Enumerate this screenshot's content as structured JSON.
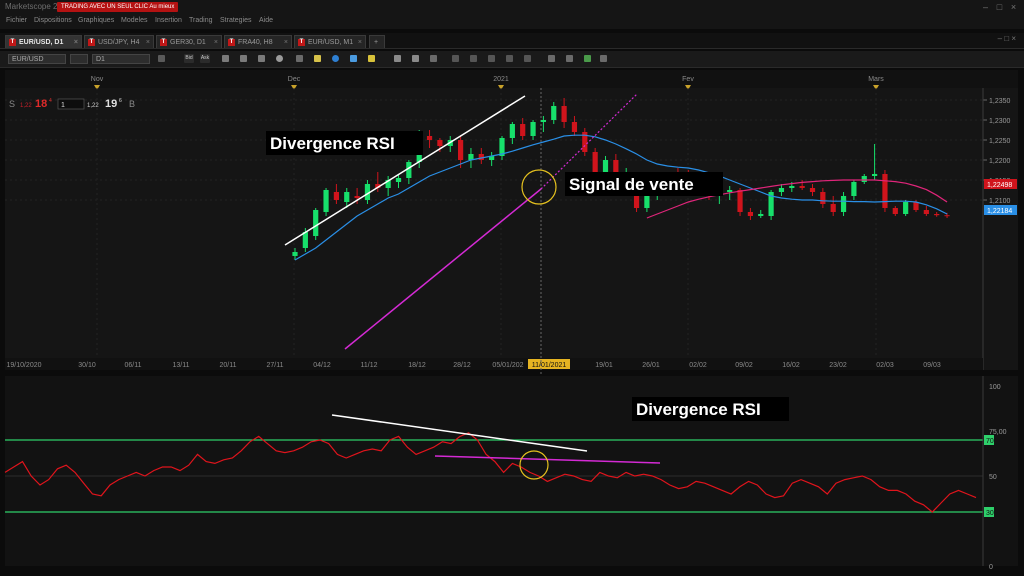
{
  "app": {
    "title": "Marketscope 2.0",
    "promo_badge": "TRADING AVEC UN SEUL CLIC Au mieux"
  },
  "menu": [
    "Fichier",
    "Dispositions",
    "Graphiques",
    "Modeles",
    "Insertion",
    "Trading",
    "Strategies",
    "Aide"
  ],
  "tabs": [
    {
      "label": "EUR/USD, D1",
      "active": true
    },
    {
      "label": "USD/JPY, H4",
      "active": false
    },
    {
      "label": "GER30, D1",
      "active": false
    },
    {
      "label": "FRA40, H8",
      "active": false
    },
    {
      "label": "EUR/USD, M1",
      "active": false
    }
  ],
  "toolbar": {
    "symbol": "EUR/USD",
    "timeframe": "D1",
    "bid_label": "Bid",
    "ask_label": "Ask"
  },
  "quote": {
    "sell_label": "S",
    "sell_prefix": "1,22",
    "sell_big": "18",
    "sell_sup": "4",
    "lots": "1",
    "buy_prefix": "1,22",
    "buy_big": "19",
    "buy_sup": "6",
    "buy_label": "B"
  },
  "months": [
    "Nov",
    "Dec",
    "2021",
    "Fev",
    "Mars"
  ],
  "price_axis": [
    "1,2350",
    "1,2300",
    "1,2250",
    "1,2200",
    "1,2150",
    "1,2100"
  ],
  "price_markers": {
    "red": "1,22498",
    "blue": "1,22184"
  },
  "date_axis": [
    "19/10/2020",
    "30/10",
    "06/11",
    "13/11",
    "20/11",
    "27/11",
    "04/12",
    "11/12",
    "18/12",
    "28/12",
    "05/01/202",
    "11/01/2021",
    "19/01",
    "26/01",
    "02/02",
    "09/02",
    "16/02",
    "23/02",
    "02/03",
    "09/03"
  ],
  "rsi_axis": [
    "100",
    "75,00",
    "70",
    "50",
    "30",
    "0"
  ],
  "annotations": {
    "divergence_top": "Divergence RSI",
    "signal": "Signal de vente",
    "divergence_rsi": "Divergence RSI"
  },
  "colors": {
    "bull": "#17e06b",
    "bear": "#d0141c",
    "ma_fast": "#2a8fe6",
    "ma_slow": "#e0257a",
    "trend": "#d42ad4",
    "rsi": "#e0141c",
    "rsi_levels": "#2ecf6a"
  },
  "chart_data": {
    "type": "candlestick",
    "x": [
      "27/11",
      "30/11",
      "01/12",
      "02/12",
      "03/12",
      "04/12",
      "07/12",
      "08/12",
      "09/12",
      "10/12",
      "11/12",
      "14/12",
      "15/12",
      "16/12",
      "17/12",
      "18/12",
      "21/12",
      "22/12",
      "23/12",
      "24/12",
      "28/12",
      "29/12",
      "30/12",
      "31/12",
      "04/01",
      "05/01",
      "06/01",
      "07/01",
      "08/01",
      "11/01",
      "12/01",
      "13/01",
      "14/01",
      "15/01",
      "18/01",
      "19/01",
      "20/01",
      "21/01",
      "22/01",
      "25/01",
      "26/01",
      "27/01",
      "28/01",
      "29/01",
      "01/02",
      "02/02",
      "08/02",
      "09/02",
      "10/02",
      "11/02",
      "12/02",
      "15/02",
      "16/02",
      "17/02",
      "18/02",
      "19/02",
      "22/02",
      "23/02",
      "24/02",
      "25/02",
      "26/02",
      "01/03",
      "02/03",
      "03/03"
    ],
    "ohlc": [
      [
        1.196,
        1.198,
        1.195,
        1.197
      ],
      [
        1.198,
        1.203,
        1.197,
        1.202
      ],
      [
        1.201,
        1.208,
        1.2,
        1.2075
      ],
      [
        1.207,
        1.213,
        1.206,
        1.2125
      ],
      [
        1.212,
        1.214,
        1.209,
        1.21
      ],
      [
        1.2095,
        1.213,
        1.208,
        1.212
      ],
      [
        1.211,
        1.213,
        1.209,
        1.2105
      ],
      [
        1.21,
        1.215,
        1.209,
        1.214
      ],
      [
        1.214,
        1.217,
        1.212,
        1.213
      ],
      [
        1.213,
        1.216,
        1.211,
        1.215
      ],
      [
        1.2145,
        1.2165,
        1.213,
        1.2155
      ],
      [
        1.2155,
        1.22,
        1.214,
        1.2195
      ],
      [
        1.2195,
        1.2275,
        1.218,
        1.2265
      ],
      [
        1.226,
        1.2275,
        1.223,
        1.225
      ],
      [
        1.225,
        1.2255,
        1.222,
        1.2235
      ],
      [
        1.2235,
        1.226,
        1.222,
        1.225
      ],
      [
        1.225,
        1.226,
        1.218,
        1.22
      ],
      [
        1.22,
        1.223,
        1.218,
        1.2215
      ],
      [
        1.2215,
        1.223,
        1.219,
        1.22
      ],
      [
        1.22,
        1.222,
        1.2185,
        1.221
      ],
      [
        1.221,
        1.226,
        1.22,
        1.2255
      ],
      [
        1.2255,
        1.2295,
        1.224,
        1.229
      ],
      [
        1.229,
        1.2305,
        1.225,
        1.226
      ],
      [
        1.226,
        1.23,
        1.225,
        1.2295
      ],
      [
        1.2295,
        1.231,
        1.227,
        1.23
      ],
      [
        1.23,
        1.2345,
        1.229,
        1.2335
      ],
      [
        1.2335,
        1.2355,
        1.228,
        1.2295
      ],
      [
        1.2295,
        1.231,
        1.226,
        1.227
      ],
      [
        1.227,
        1.228,
        1.221,
        1.222
      ],
      [
        1.222,
        1.223,
        1.215,
        1.216
      ],
      [
        1.216,
        1.221,
        1.215,
        1.22
      ],
      [
        1.22,
        1.2215,
        1.214,
        1.215
      ],
      [
        1.215,
        1.218,
        1.214,
        1.2165
      ],
      [
        1.2165,
        1.217,
        1.207,
        1.208
      ],
      [
        1.208,
        1.212,
        1.207,
        1.211
      ],
      [
        1.211,
        1.216,
        1.21,
        1.2155
      ],
      [
        1.2155,
        1.217,
        1.214,
        1.2165
      ],
      [
        1.2165,
        1.218,
        1.215,
        1.216
      ],
      [
        1.216,
        1.2175,
        1.211,
        1.212
      ],
      [
        1.212,
        1.216,
        1.211,
        1.215
      ],
      [
        1.215,
        1.2155,
        1.21,
        1.211
      ],
      [
        1.211,
        1.213,
        1.209,
        1.212
      ],
      [
        1.212,
        1.2135,
        1.21,
        1.2125
      ],
      [
        1.2125,
        1.213,
        1.206,
        1.207
      ],
      [
        1.207,
        1.208,
        1.205,
        1.206
      ],
      [
        1.206,
        1.2075,
        1.2055,
        1.2065
      ],
      [
        1.206,
        1.2125,
        1.205,
        1.212
      ],
      [
        1.212,
        1.214,
        1.211,
        1.213
      ],
      [
        1.213,
        1.2145,
        1.212,
        1.2135
      ],
      [
        1.2135,
        1.215,
        1.2125,
        1.213
      ],
      [
        1.213,
        1.214,
        1.211,
        1.212
      ],
      [
        1.212,
        1.213,
        1.208,
        1.209
      ],
      [
        1.209,
        1.211,
        1.206,
        1.207
      ],
      [
        1.207,
        1.212,
        1.206,
        1.211
      ],
      [
        1.211,
        1.215,
        1.21,
        1.2145
      ],
      [
        1.2145,
        1.2165,
        1.214,
        1.216
      ],
      [
        1.216,
        1.224,
        1.215,
        1.2165
      ],
      [
        1.2165,
        1.2175,
        1.207,
        1.208
      ],
      [
        1.208,
        1.2085,
        1.206,
        1.2065
      ],
      [
        1.2065,
        1.21,
        1.206,
        1.2095
      ],
      [
        1.2095,
        1.21,
        1.207,
        1.2075
      ],
      [
        1.2075,
        1.2085,
        1.206,
        1.2065
      ],
      [
        1.2065,
        1.207,
        1.2058,
        1.2062
      ],
      [
        1.2062,
        1.2068,
        1.2055,
        1.206
      ]
    ],
    "ma_fast": [
      1.195,
      1.1965,
      1.198,
      1.2,
      1.202,
      1.204,
      1.206,
      1.2075,
      1.209,
      1.2105,
      1.2115,
      1.213,
      1.2145,
      1.216,
      1.217,
      1.218,
      1.219,
      1.22,
      1.2205,
      1.221,
      1.2215,
      1.2222,
      1.223,
      1.2238,
      1.2245,
      1.2252,
      1.226,
      1.2262,
      1.2262,
      1.2258,
      1.225,
      1.224,
      1.2228,
      1.2215,
      1.22,
      1.219,
      1.2185,
      1.2182,
      1.218,
      1.2175,
      1.2168,
      1.216,
      1.215,
      1.214,
      1.213,
      1.212,
      1.211,
      1.2105,
      1.2102,
      1.21,
      1.21,
      1.2098,
      1.2097,
      1.2097,
      1.2096,
      1.2096,
      1.2095,
      1.2096,
      1.2097,
      1.2097,
      1.2095,
      1.2088,
      1.2078,
      1.2065
    ],
    "ma_slow": [
      null,
      null,
      null,
      null,
      null,
      null,
      null,
      null,
      null,
      null,
      null,
      null,
      null,
      null,
      null,
      null,
      null,
      null,
      null,
      null,
      null,
      null,
      null,
      null,
      null,
      null,
      null,
      null,
      null,
      null,
      null,
      null,
      null,
      null,
      1.2055,
      1.2065,
      1.2075,
      1.2085,
      1.2095,
      1.2102,
      1.2108,
      1.2113,
      1.2118,
      1.2122,
      1.2126,
      1.213,
      1.2134,
      1.2138,
      1.2141,
      1.2144,
      1.2146,
      1.2148,
      1.2149,
      1.215,
      1.215,
      1.215,
      1.215,
      1.2148,
      1.2146,
      1.2142,
      1.2135,
      1.2126,
      1.2112,
      1.2095
    ],
    "rsi_values": [
      52,
      55,
      58,
      50,
      45,
      48,
      54,
      56,
      52,
      46,
      40,
      39,
      45,
      48,
      50,
      52,
      50,
      53,
      55,
      55,
      53,
      56,
      62,
      58,
      57,
      59,
      60,
      64,
      69,
      72,
      68,
      64,
      63,
      64,
      66,
      69,
      70,
      68,
      62,
      60,
      62,
      64,
      65,
      64,
      70,
      72,
      66,
      62,
      64,
      66,
      69,
      68,
      72,
      74,
      70,
      62,
      58,
      52,
      57,
      55,
      52,
      50,
      47,
      49,
      51,
      50,
      48,
      47,
      52,
      50,
      49,
      52,
      50,
      51,
      50,
      48,
      45,
      43,
      44,
      47,
      46,
      44,
      42,
      40,
      44,
      47,
      45,
      40,
      38,
      39,
      46,
      48,
      46,
      44,
      40,
      46,
      48,
      49,
      50,
      48,
      44,
      42,
      42,
      40,
      36,
      34,
      30,
      35,
      40,
      42,
      40,
      38
    ]
  }
}
